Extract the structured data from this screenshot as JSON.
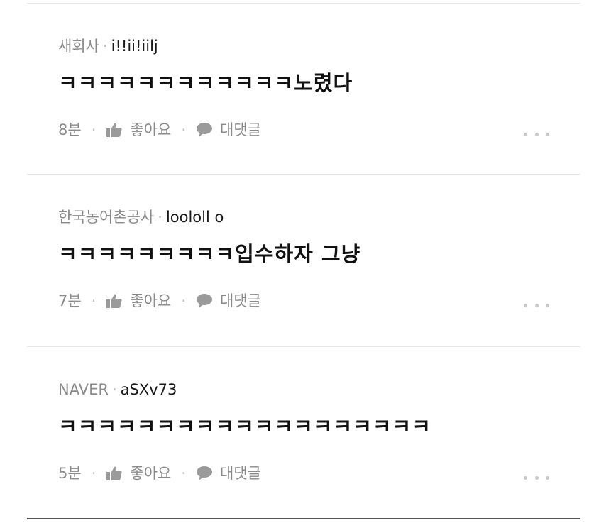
{
  "comments": [
    {
      "source": "새회사",
      "username": "i!!ii!iilj",
      "text": "ㅋㅋㅋㅋㅋㅋㅋㅋㅋㅋㅋㅋ노렸다",
      "time": "8분",
      "like_label": "좋아요",
      "reply_label": "대댓글"
    },
    {
      "source": "한국농어촌공사",
      "username": "loololl o",
      "text": "ㅋㅋㅋㅋㅋㅋㅋㅋㅋ입수하자 그냥",
      "time": "7분",
      "like_label": "좋아요",
      "reply_label": "대댓글"
    },
    {
      "source": "NAVER",
      "username": "aSXv73",
      "text": "ㅋㅋㅋㅋㅋㅋㅋㅋㅋㅋㅋㅋㅋㅋㅋㅋㅋㅋㅋ",
      "time": "5분",
      "like_label": "좋아요",
      "reply_label": "대댓글"
    }
  ],
  "separator": "·",
  "icons": {
    "like": "thumbs-up-icon",
    "reply": "speech-bubble-icon",
    "more": "more-dots-icon"
  },
  "colors": {
    "meta": "#8a8a8a",
    "text": "#111111",
    "icon": "#9a9a9a",
    "divider": "#e6e6e6"
  }
}
